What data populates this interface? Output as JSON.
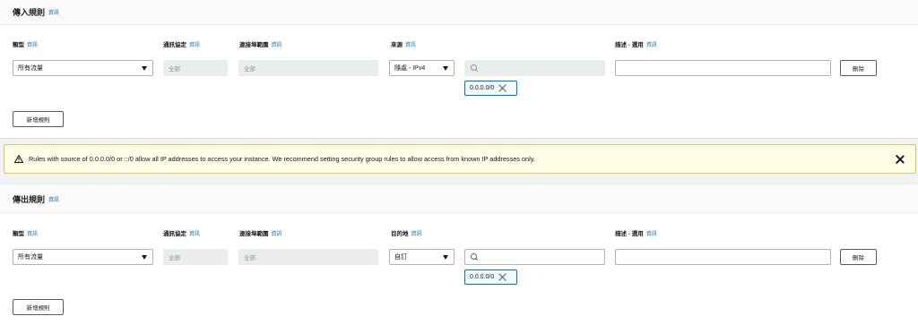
{
  "inbound": {
    "title": "傳入規則",
    "info": "資訊",
    "labels": {
      "type": "類型",
      "protocol": "通訊協定",
      "port_range": "連接埠範圍",
      "source": "來源",
      "description": "描述 - 選用"
    },
    "row": {
      "type_value": "所有流量",
      "protocol_value": "全部",
      "port_value": "全部",
      "source_value": "隨處 - IPv4",
      "cidr_token": "0.0.0.0/0",
      "delete_label": "刪除"
    },
    "add_rule_label": "新增規則"
  },
  "alert": {
    "message": "Rules with source of 0.0.0.0/0 or ::/0 allow all IP addresses to access your instance. We recommend setting security group rules to allow access from known IP addresses only."
  },
  "outbound": {
    "title": "傳出規則",
    "info": "資訊",
    "labels": {
      "type": "類型",
      "protocol": "通訊協定",
      "port_range": "連接埠範圍",
      "destination": "目的地",
      "description": "描述 - 選用"
    },
    "row": {
      "type_value": "所有流量",
      "protocol_value": "全部",
      "port_value": "全部",
      "destination_value": "自訂",
      "cidr_token": "0.0.0.0/0",
      "delete_label": "刪除"
    },
    "add_rule_label": "新增規則"
  },
  "icons": {
    "warning": "warning-icon",
    "search": "search-icon",
    "remove": "close-icon",
    "caret": "caret-down-icon"
  },
  "colors": {
    "info_link": "#0073bb",
    "warning_bg": "#fffce6",
    "warning_border": "#e0c45c",
    "token_border": "#0073bb"
  }
}
